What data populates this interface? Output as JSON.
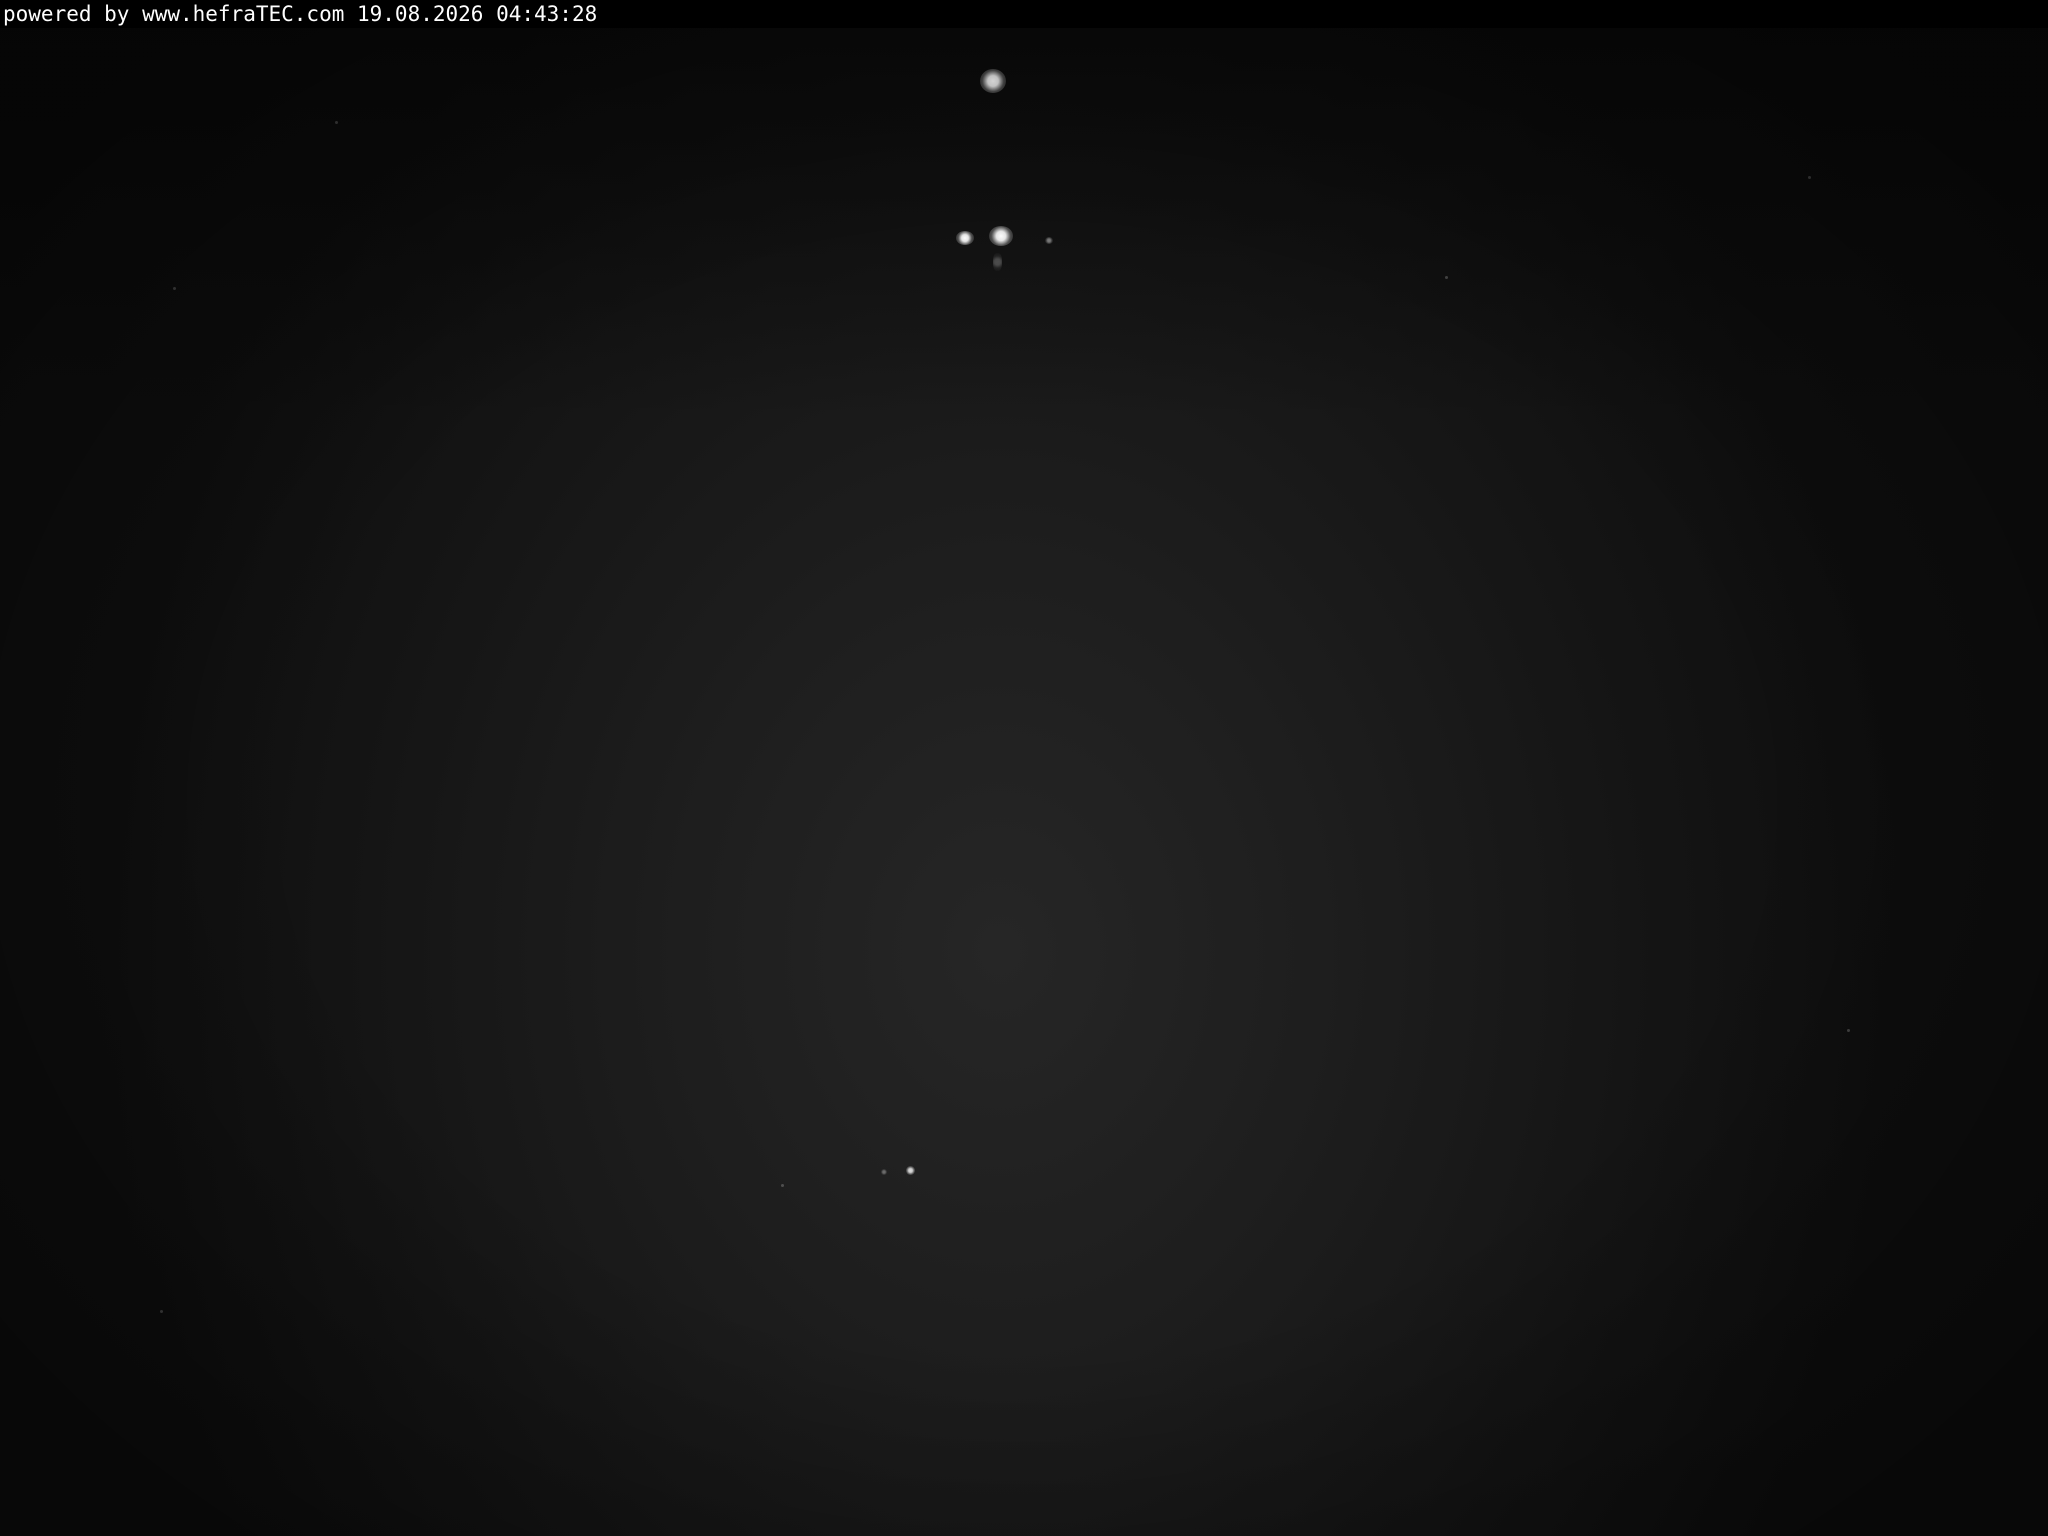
{
  "overlay": {
    "caption": "powered by www.hefraTEC.com 19.08.2026 04:43:28"
  },
  "scene": {
    "colors": {
      "overlay_bar": "#000000",
      "overlay_text": "#ffffff",
      "sky": "#1e1e1e",
      "light": "#ffffff"
    }
  }
}
